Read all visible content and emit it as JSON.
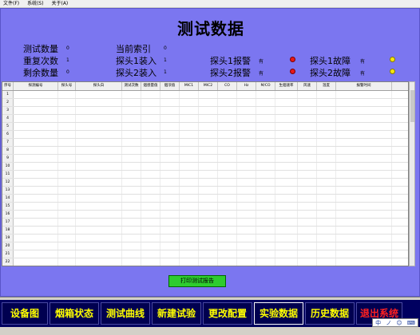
{
  "menu": [
    "文件(F)",
    "系统(S)",
    "关于(A)"
  ],
  "title": "测试数据",
  "info": {
    "count_label": "测试数量",
    "count_value": "0",
    "repeat_label": "重复次数",
    "repeat_value": "1",
    "remain_label": "剩余数量",
    "remain_value": "0",
    "index_label": "当前索引",
    "index_value": "0",
    "probe1_load_label": "探头1装入",
    "probe1_load_value": "1",
    "probe2_load_label": "探头2装入",
    "probe2_load_value": "1",
    "probe1_alarm_label": "探头1报警",
    "probe1_alarm_value": "有",
    "probe2_alarm_label": "探头2报警",
    "probe2_alarm_value": "有",
    "probe1_fault_label": "探头1故障",
    "probe1_fault_value": "有",
    "probe2_fault_label": "探头2故障",
    "probe2_fault_value": "有"
  },
  "status_colors": {
    "alarm": "#e81818",
    "fault": "#f5e60e"
  },
  "table": {
    "headers": [
      "序号",
      "探测编号",
      "探头号",
      "探头白",
      "测试次数",
      "烟感量值",
      "烟浓值",
      "MIC1",
      "MIC2",
      "CO",
      "Hz",
      "M/CO",
      "生烟速率",
      "风速",
      "温度",
      "报警时间"
    ],
    "rows": [
      "1",
      "2",
      "3",
      "4",
      "5",
      "6",
      "7",
      "8",
      "9",
      "10",
      "11",
      "12",
      "13",
      "14",
      "15",
      "16",
      "17",
      "18",
      "19",
      "20",
      "21",
      "22"
    ]
  },
  "print_button": "打印测试报告",
  "nav": [
    "设备图",
    "烟箱状态",
    "测试曲线",
    "新建试验",
    "更改配置",
    "实验数据",
    "历史数据",
    "退出系统"
  ],
  "tray": [
    "中",
    "ノ",
    "☺",
    "⌨"
  ]
}
